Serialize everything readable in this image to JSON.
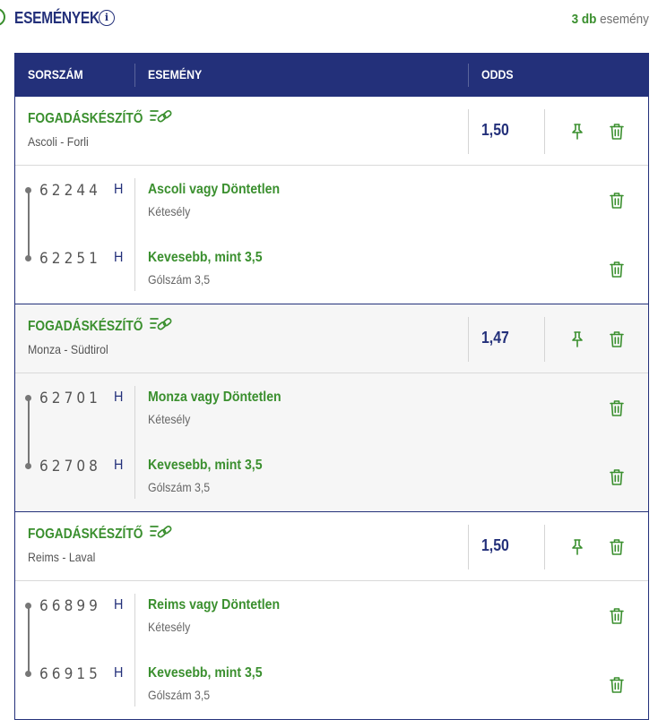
{
  "header": {
    "title": "ESEMÉNYEK",
    "count_number": "3 db",
    "count_label": "esemény"
  },
  "table": {
    "columns": [
      "SORSZÁM",
      "ESEMÉNY",
      "ODDS"
    ]
  },
  "groups": [
    {
      "name": "FOGADÁSKÉSZÍTŐ",
      "match": "Ascoli - Forli",
      "odds": "1,50",
      "selections": [
        {
          "code": "62244",
          "flag": "H",
          "selection": "Ascoli vagy Döntetlen",
          "market": "Kétesély"
        },
        {
          "code": "62251",
          "flag": "H",
          "selection": "Kevesebb, mint 3,5",
          "market": "Gólszám 3,5"
        }
      ]
    },
    {
      "name": "FOGADÁSKÉSZÍTŐ",
      "match": "Monza - Südtirol",
      "odds": "1,47",
      "selections": [
        {
          "code": "62701",
          "flag": "H",
          "selection": "Monza vagy Döntetlen",
          "market": "Kétesély"
        },
        {
          "code": "62708",
          "flag": "H",
          "selection": "Kevesebb, mint 3,5",
          "market": "Gólszám 3,5"
        }
      ]
    },
    {
      "name": "FOGADÁSKÉSZÍTŐ",
      "match": "Reims - Laval",
      "odds": "1,50",
      "selections": [
        {
          "code": "66899",
          "flag": "H",
          "selection": "Reims vagy Döntetlen",
          "market": "Kétesély"
        },
        {
          "code": "66915",
          "flag": "H",
          "selection": "Kevesebb, mint 3,5",
          "market": "Gólszám 3,5"
        }
      ]
    }
  ],
  "icons": {
    "info": "info-icon",
    "builder": "bet-builder-link-icon",
    "pin": "pin-icon",
    "delete": "trash-icon"
  },
  "colors": {
    "navy": "#23307a",
    "green": "#3a8f2e",
    "alt_row": "#f6f6f6"
  }
}
